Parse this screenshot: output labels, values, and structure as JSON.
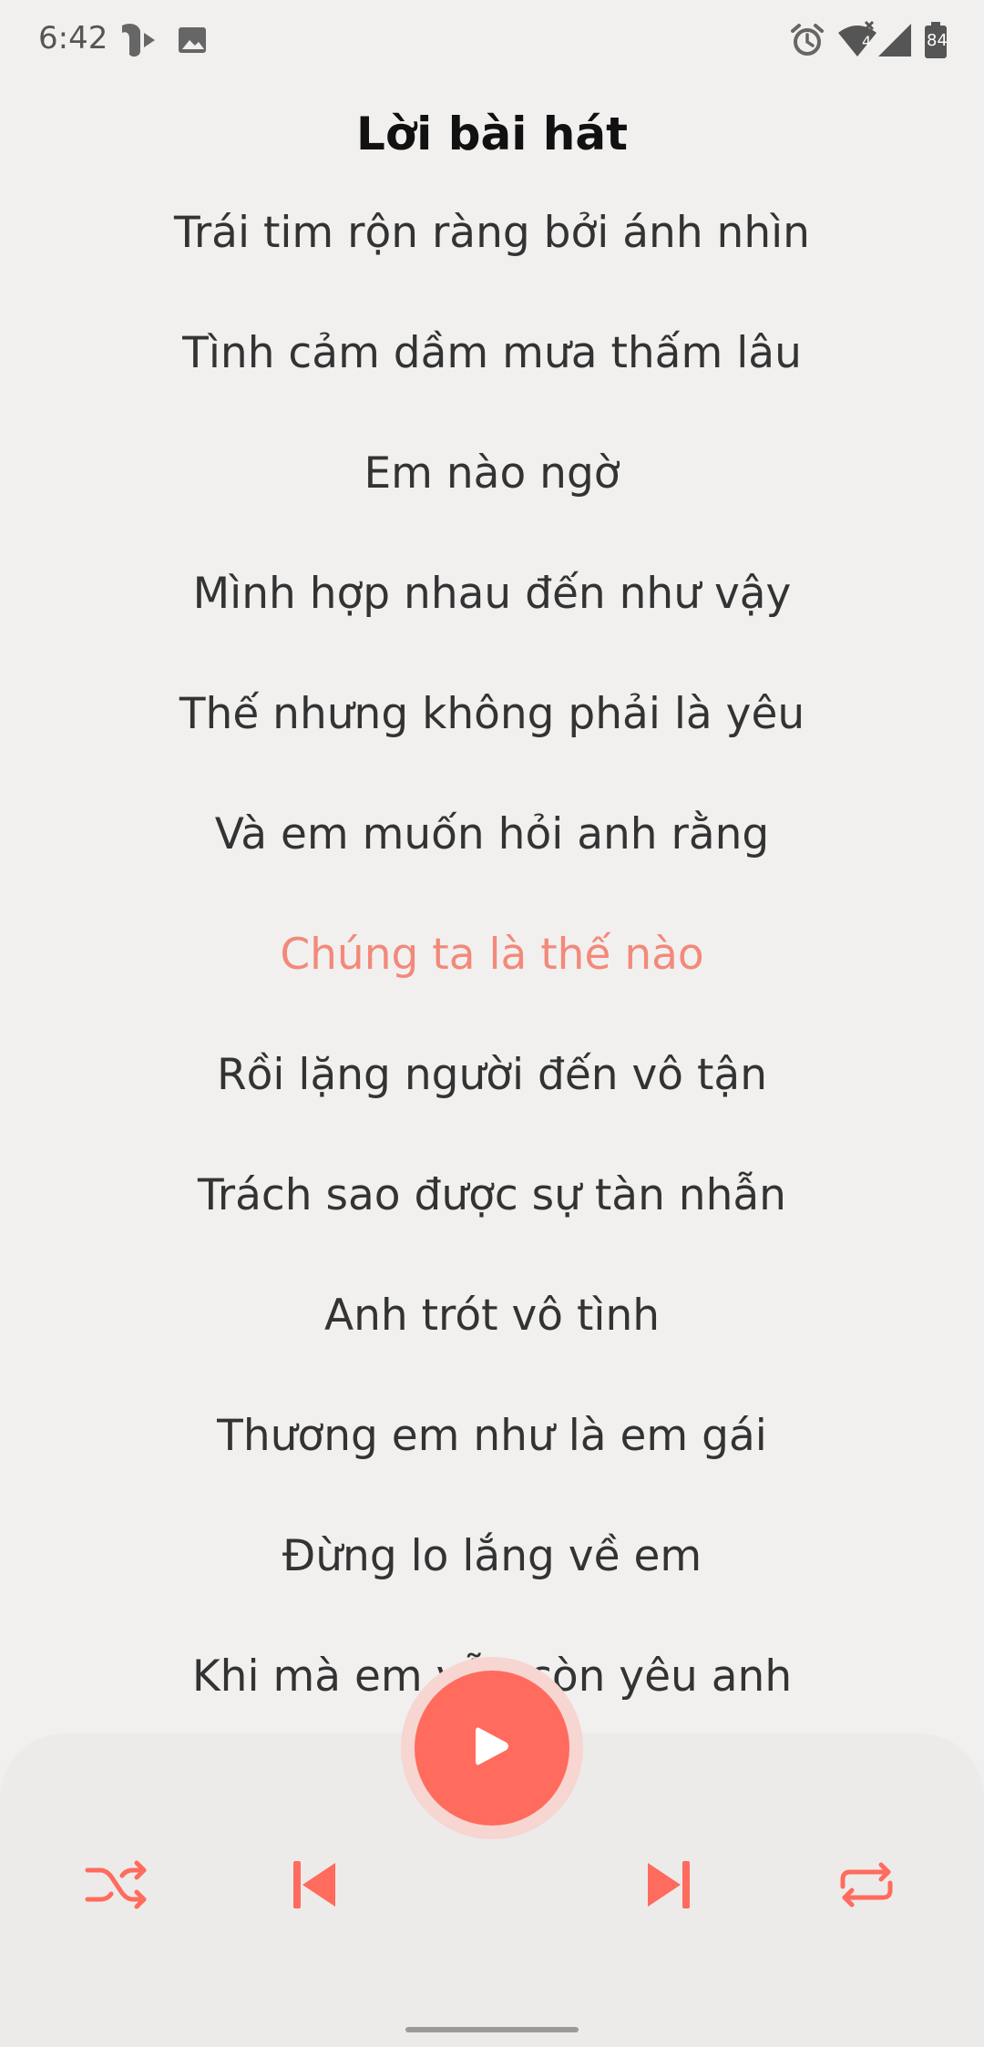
{
  "status_bar": {
    "time": "6:42",
    "battery_level": "84",
    "network_badge": "4"
  },
  "header": {
    "title": "Lời bài hát"
  },
  "lyrics": {
    "lines": [
      "Trái tim rộn ràng bởi ánh nhìn",
      "Tình cảm dầm mưa thấm lâu",
      "Em nào ngờ",
      "Mình hợp nhau đến như vậy",
      "Thế nhưng không phải là yêu",
      "Và em muốn hỏi anh rằng",
      "Chúng ta là thế nào",
      "Rồi lặng người đến vô tận",
      "Trách sao được sự tàn nhẫn",
      "Anh trót vô tình",
      "Thương em như là em gái",
      "Đừng lo lắng về em",
      "Khi mà em vẫn còn yêu anh"
    ],
    "active_index": 6
  },
  "controls": {
    "shuffle_icon": "shuffle-icon",
    "previous_icon": "skip-previous-icon",
    "play_icon": "play-icon",
    "next_icon": "skip-next-icon",
    "repeat_icon": "repeat-icon"
  },
  "colors": {
    "accent": "#ff6b5d",
    "active_lyric": "#f3897a",
    "background": "#f1f0ef"
  }
}
